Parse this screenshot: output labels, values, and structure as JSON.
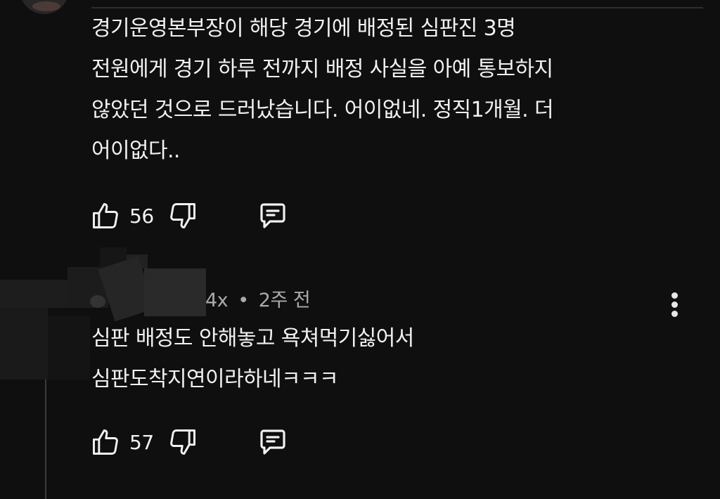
{
  "comments": [
    {
      "text_lines": [
        "경기운영본부장이 해당 경기에 배정된 심판진 3명",
        "전원에게 경기 하루 전까지 배정 사실을 아예 통보하지",
        "않았던 것으로 드러났습니다.  어이없네. 정직1개월. 더",
        "어이없다.."
      ],
      "like_count": "56"
    },
    {
      "author_suffix": "4x",
      "separator": "•",
      "time_ago": "2주 전",
      "text_lines": [
        "심판 배정도 안해놓고 욕쳐먹기싫어서",
        "심판도착지연이라하네ㅋㅋㅋ"
      ],
      "like_count": "57"
    }
  ],
  "icons": {
    "like": "thumbs-up-icon",
    "dislike": "thumbs-down-icon",
    "reply": "reply-comment-icon",
    "more": "more-vert-icon"
  },
  "colors": {
    "background": "#0f0f0f",
    "text": "#f1f1f1",
    "meta": "#aaaaaa"
  }
}
